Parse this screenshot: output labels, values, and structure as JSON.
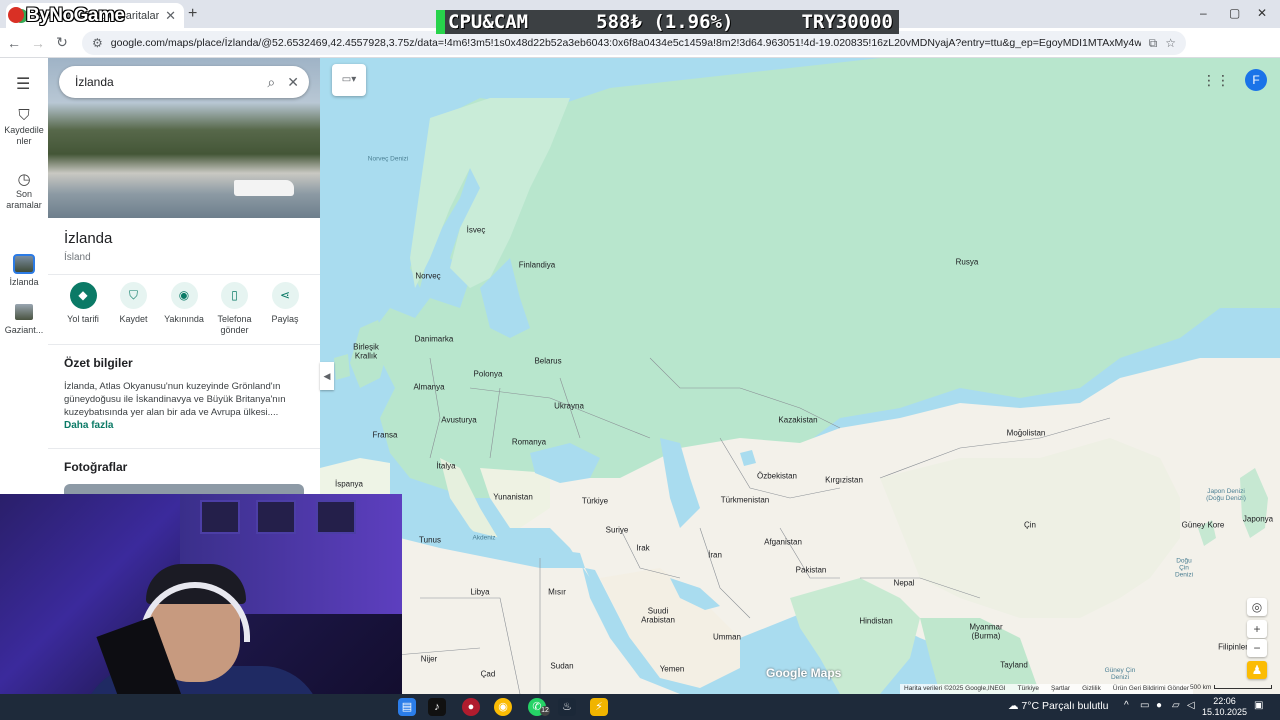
{
  "browser": {
    "tab_title": "İzlanda - Google Haritalar",
    "tab_close": "✕",
    "new_tab": "+",
    "brand_overlay": "ByNoGame",
    "url": "google.com/maps/place/İzlanda/@52.6532469,42.4557928,3.75z/data=!4m6!3m5!1s0x48d22b52a3eb6043:0x6f8a0434e5c1459a!8m2!3d64.963051!4d-19.020835!16zL20vMDNyajA?entry=ttu&g_ep=EgoyMDI1MTAxMy4wIKXMDSoASAFQAw%3D%3D",
    "profile_initial": "F",
    "window_controls": [
      "–",
      "▢",
      "✕"
    ]
  },
  "stream_ticker": {
    "left": "CPU&CAM",
    "middle": "588₺ (1.96%)",
    "right": "TRY30000"
  },
  "rail": {
    "items": [
      {
        "label": "Kaydedilenler",
        "icon": "bookmark-icon"
      },
      {
        "label": "Son aramalar",
        "icon": "history-icon"
      },
      {
        "label": "İzlanda",
        "icon": "thumbnail"
      },
      {
        "label": "Gaziant...",
        "icon": "thumbnail"
      }
    ],
    "label_lines": [
      "Kaydedile",
      "nler",
      "Son",
      "aramalar"
    ]
  },
  "panel": {
    "search_value": "İzlanda",
    "title": "İzlanda",
    "subtitle": "Ísland",
    "actions": [
      {
        "label": "Yol tarifi",
        "icon": "directions-icon",
        "glyph": "◆"
      },
      {
        "label": "Kaydet",
        "icon": "bookmark-icon",
        "glyph": "⛉"
      },
      {
        "label": "Yakınında",
        "icon": "nearby-icon",
        "glyph": "◉"
      },
      {
        "label_line1": "Telefona",
        "label_line2": "gönder",
        "icon": "phone-icon",
        "glyph": "▯"
      },
      {
        "label": "Paylaş",
        "icon": "share-icon",
        "glyph": "⋖"
      }
    ],
    "summary_heading": "Özet bilgiler",
    "summary_text": "İzlanda, Atlas Okyanusu'nun kuzeyinde Grönland'ın güneydoğusu ile İskandinavya ve Büyük Britanya'nın kuzeybatısında yer alan bir ada ve Avrupa ülkesi....",
    "more_link": "Daha fazla",
    "photos_heading": "Fotoğraflar"
  },
  "map": {
    "labels": {
      "sea_norway": "Norveç Denizi",
      "sea_med": "Akdeniz",
      "sea_japan": "Japon Denizi (Doğu Denizi)",
      "sea_east_china": "Doğu Çin Denizi",
      "sea_south_china": "Güney Çin Denizi",
      "sweden": "İsveç",
      "finland": "Finlandiya",
      "norway": "Norveç",
      "russia": "Rusya",
      "uk_1": "Birleşik",
      "uk_2": "Krallık",
      "denmark": "Danimarka",
      "belarus": "Belarus",
      "poland": "Polonya",
      "germany": "Almanya",
      "ukraine": "Ukrayna",
      "kazakhstan": "Kazakistan",
      "mongolia": "Moğolistan",
      "france": "Fransa",
      "austria": "Avusturya",
      "romania": "Romanya",
      "italy": "İtalya",
      "spain": "İspanya",
      "greece": "Yunanistan",
      "turkey": "Türkiye",
      "uzbekistan": "Özbekistan",
      "kyrgyzstan": "Kırgızistan",
      "turkmenistan": "Türkmenistan",
      "south_korea": "Güney Kore",
      "japan": "Japonya",
      "china": "Çin",
      "tunisia": "Tunus",
      "syria": "Suriye",
      "iraq": "Irak",
      "iran": "İran",
      "afghanistan": "Afganistan",
      "pakistan": "Pakistan",
      "nepal": "Nepal",
      "libya": "Libya",
      "egypt": "Mısır",
      "saudi_1": "Suudi",
      "saudi_2": "Arabistan",
      "oman": "Umman",
      "india": "Hindistan",
      "myanmar_1": "Myanmar",
      "myanmar_2": "(Burma)",
      "philippines": "Filipinler",
      "thailand": "Tayland",
      "niger": "Nijer",
      "chad": "Çad",
      "sudan": "Sudan",
      "yemen": "Yemen"
    },
    "watermark": "Google Maps",
    "attribution": [
      "Harita verileri ©2025 Google,INEGI",
      "Türkiye",
      "Şartlar",
      "Gizlilik",
      "Ürün Geri Bildirimi Gönder"
    ],
    "scale": "500 km",
    "account_initial": "F",
    "colors": {
      "water": "#a9dcef",
      "land_green": "#b8e6cd",
      "land_desert": "#f3f1ea",
      "border": "#8a8f95"
    }
  },
  "taskbar": {
    "weather": "7°C  Parçalı bulutlu",
    "time": "22:06",
    "date": "15.10.2025",
    "whatsapp_badge": "12"
  }
}
